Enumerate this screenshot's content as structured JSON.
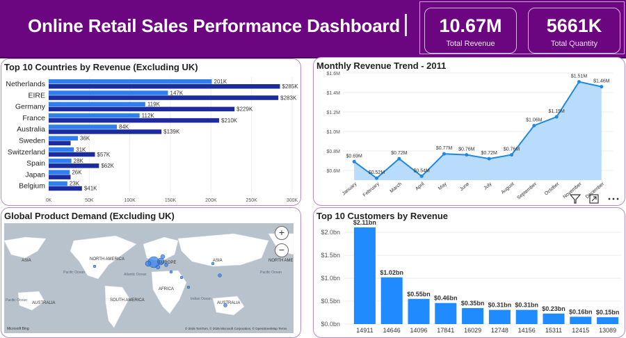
{
  "header": {
    "title": "Online Retail Sales Performance Dashboard",
    "kpis": [
      {
        "value": "10.67M",
        "label": "Total Revenue"
      },
      {
        "value": "5661K",
        "label": "Total Quantity"
      }
    ]
  },
  "panels": {
    "countries": {
      "title": "Top 10 Countries by Revenue (Excluding UK)"
    },
    "monthly": {
      "title": "Monthly Revenue Trend - 2011"
    },
    "map": {
      "title": "Global Product Demand (Excluding UK)"
    },
    "customers": {
      "title": "Top 10 Customers by Revenue"
    }
  },
  "map": {
    "labels": [
      "NORTH AMERICA",
      "ASIA",
      "EUROPE",
      "AFRICA",
      "SOUTH AMERICA",
      "AUSTRALIA",
      "Pacific Ocean",
      "Atlantic Ocean",
      "Indian Ocean"
    ],
    "footer": "© 2025 TomTom, © 2025 Microsoft Corporation, © OpenStreetMap  Terms",
    "brand": "Microsoft Bing"
  },
  "chart_data": [
    {
      "type": "bar",
      "title": "Top 10 Countries by Revenue (Excluding UK)",
      "categories": [
        "Netherlands",
        "EIRE",
        "Germany",
        "France",
        "Australia",
        "Sweden",
        "Switzerland",
        "Spain",
        "Japan",
        "Belgium"
      ],
      "series": [
        {
          "values": [
            201,
            147,
            119,
            112,
            84,
            36,
            31,
            28,
            26,
            23
          ],
          "labels": [
            "201K",
            "147K",
            "119K",
            "112K",
            "84K",
            "36K",
            "31K",
            "28K",
            "26K",
            "23K"
          ],
          "color": "#2f7ff0"
        },
        {
          "values": [
            285,
            283,
            229,
            210,
            139,
            27,
            57,
            62,
            27,
            41
          ],
          "labels": [
            "$285K",
            "$283K",
            "$229K",
            "$210K",
            "$139K",
            "",
            "$57K",
            "$62K",
            "",
            "$41K"
          ],
          "color": "#1c2c9e"
        }
      ],
      "xticks": [
        "0K",
        "50K",
        "100K",
        "150K",
        "200K",
        "250K",
        "300K"
      ],
      "xlim": [
        0,
        300
      ]
    },
    {
      "type": "area",
      "title": "Monthly Revenue Trend - 2011",
      "categories": [
        "January",
        "February",
        "March",
        "April",
        "May",
        "June",
        "July",
        "August",
        "September",
        "October",
        "November",
        "December"
      ],
      "values": [
        0.69,
        0.52,
        0.72,
        0.54,
        0.77,
        0.76,
        0.72,
        0.76,
        1.06,
        1.15,
        1.51,
        1.46
      ],
      "labels": [
        "$0.69M",
        "$0.52M",
        "$0.72M",
        "$0.54M",
        "$0.77M",
        "$0.76M",
        "$0.72M",
        "$0.76M",
        "$1.06M",
        "$1.15M",
        "$1.51M",
        "$1.46M"
      ],
      "yticks": [
        "$0.6M",
        "$0.8M",
        "$1.0M",
        "$1.2M",
        "$1.4M",
        "$1.6M"
      ],
      "ylim": [
        0.5,
        1.6
      ]
    },
    {
      "type": "bar",
      "title": "Top 10 Customers by Revenue",
      "categories": [
        "14911",
        "14646",
        "14096",
        "17841",
        "16029",
        "12748",
        "14156",
        "15311",
        "12415",
        "13089"
      ],
      "values": [
        2.11,
        1.02,
        0.55,
        0.46,
        0.35,
        0.31,
        0.31,
        0.23,
        0.16,
        0.15
      ],
      "labels": [
        "$2.11bn",
        "$1.02bn",
        "$0.55bn",
        "$0.46bn",
        "$0.35bn",
        "$0.31bn",
        "$0.31bn",
        "$0.23bn",
        "$0.16bn",
        "$0.15bn"
      ],
      "yticks": [
        "$0.0bn",
        "$0.5bn",
        "$1.0bn",
        "$1.5bn",
        "$2.0bn"
      ],
      "ylim": [
        0,
        2.2
      ]
    }
  ]
}
